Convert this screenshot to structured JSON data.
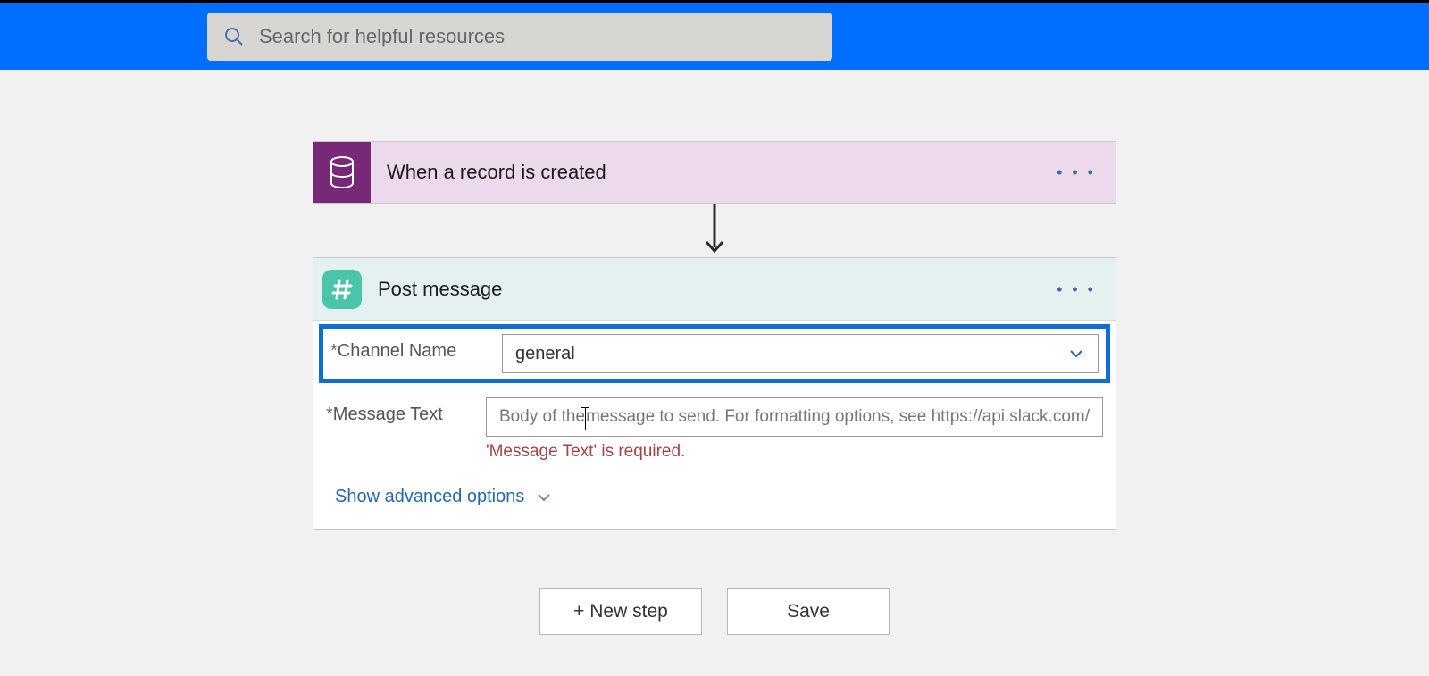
{
  "search": {
    "placeholder": "Search for helpful resources"
  },
  "trigger": {
    "title": "When a record is created"
  },
  "action": {
    "title": "Post message",
    "fields": {
      "channel": {
        "label": "Channel Name",
        "value": "general"
      },
      "message": {
        "label": "Message Text",
        "placeholder_before": "Body of the ",
        "placeholder_after": "message to send. For formatting options, see https://api.slack.com/",
        "validation": "'Message Text' is required."
      }
    },
    "advanced_label": "Show advanced options"
  },
  "buttons": {
    "new_step": "+ New step",
    "save": "Save"
  }
}
